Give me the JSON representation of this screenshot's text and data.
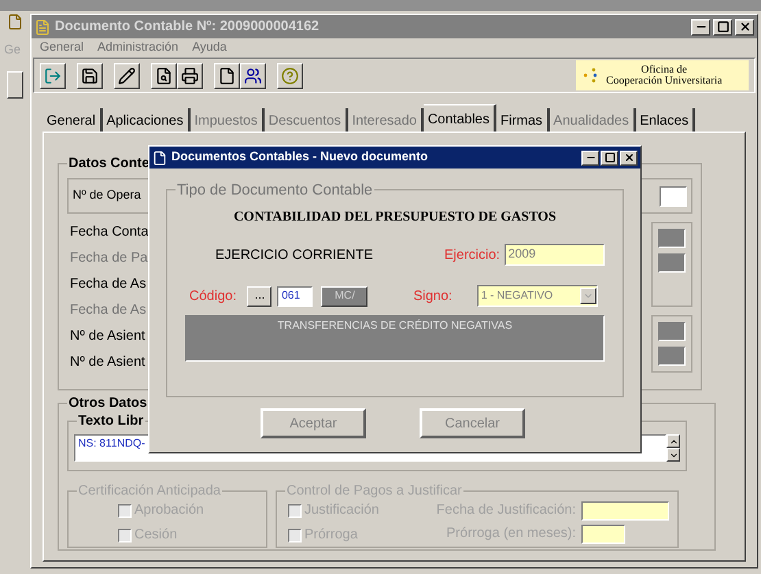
{
  "background_app": {
    "menu_fragment": "Ge"
  },
  "window": {
    "title": "Documento Contable Nº: 2009000004162"
  },
  "menu": [
    {
      "label": "General",
      "disabled": true
    },
    {
      "label": "Administración",
      "disabled": true
    },
    {
      "label": "Ayuda",
      "disabled": true
    }
  ],
  "logo": {
    "line_1": "Oficina de",
    "line_2": "Cooperación Universitaria"
  },
  "tabs": [
    {
      "label": "General",
      "selected": false,
      "disabled": false
    },
    {
      "label": "Aplicaciones",
      "selected": false,
      "disabled": false
    },
    {
      "label": "Impuestos",
      "selected": false,
      "disabled": true
    },
    {
      "label": "Descuentos",
      "selected": false,
      "disabled": true
    },
    {
      "label": "Interesado",
      "selected": false,
      "disabled": true
    },
    {
      "label": "Contables",
      "selected": true,
      "disabled": false
    },
    {
      "label": "Firmas",
      "selected": false,
      "disabled": false
    },
    {
      "label": "Anualidades",
      "selected": false,
      "disabled": true
    },
    {
      "label": "Enlaces",
      "selected": false,
      "disabled": false
    }
  ],
  "datos_contables": {
    "title": "Datos Conte",
    "operacion_label": "Nº de Opera",
    "rows": [
      {
        "label": "Fecha Conta",
        "disabled": false
      },
      {
        "label": "Fecha de Pa",
        "disabled": true
      },
      {
        "label": "Fecha de As",
        "disabled": false
      },
      {
        "label": "Fecha de As",
        "disabled": true
      },
      {
        "label": "Nº de Asient",
        "disabled": false
      },
      {
        "label": "Nº de Asient",
        "disabled": false
      }
    ]
  },
  "otros_datos": {
    "title": "Otros Datos",
    "texto_libre": {
      "title": "Texto Libr",
      "value": "NS: 811NDQ-"
    }
  },
  "certificacion": {
    "title": "Certificación Anticipada",
    "checks": [
      {
        "label": "Aprobación",
        "checked": false
      },
      {
        "label": "Cesión",
        "checked": false
      }
    ]
  },
  "control_pagos": {
    "title": "Control de Pagos a Justificar",
    "checks": [
      {
        "label": "Justificación",
        "checked": false
      },
      {
        "label": "Prórroga",
        "checked": false
      }
    ],
    "fields": [
      {
        "label": "Fecha de Justificación:"
      },
      {
        "label": "Prórroga (en meses):"
      }
    ]
  },
  "dialog": {
    "title": "Documentos Contables - Nuevo documento",
    "group_title": "Tipo de Documento Contable",
    "heading": "CONTABILIDAD DEL PRESUPUESTO DE GASTOS",
    "ejercicio_type": "EJERCICIO CORRIENTE",
    "ejercicio": {
      "label": "Ejercicio:",
      "value": "2009"
    },
    "codigo": {
      "label": "Código:",
      "browse": "...",
      "value": "061",
      "button": "MC/"
    },
    "signo": {
      "label": "Signo:",
      "value": "1 - NEGATIVO"
    },
    "description": "TRANSFERENCIAS DE CRÉDITO NEGATIVAS",
    "buttons": [
      {
        "label": "Aceptar",
        "disabled": true
      },
      {
        "label": "Cancelar",
        "disabled": true
      }
    ]
  }
}
